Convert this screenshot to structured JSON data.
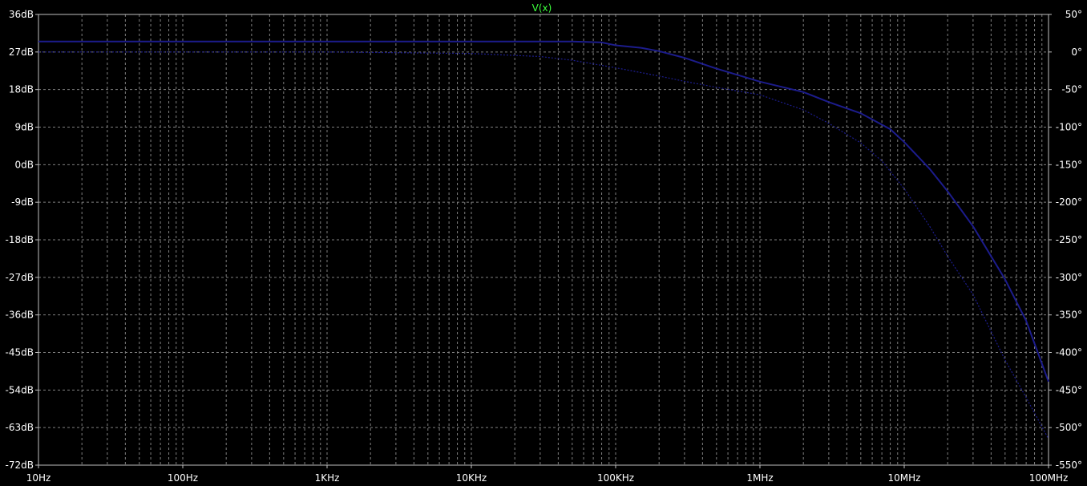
{
  "chart_data": {
    "type": "line",
    "title": "V(x)",
    "xlabel": "",
    "ylabel": "",
    "y2label": "",
    "x_scale": "log",
    "xlim": [
      10,
      100000000
    ],
    "ylim": [
      -72,
      36
    ],
    "y2lim": [
      -550,
      50
    ],
    "x_ticks": [
      "10Hz",
      "100Hz",
      "1KHz",
      "10KHz",
      "100KHz",
      "1MHz",
      "10MHz",
      "100MHz"
    ],
    "y_ticks": [
      "36dB",
      "27dB",
      "18dB",
      "9dB",
      "0dB",
      "-9dB",
      "-18dB",
      "-27dB",
      "-36dB",
      "-45dB",
      "-54dB",
      "-63dB",
      "-72dB"
    ],
    "y2_ticks": [
      "50°",
      "0°",
      "-50°",
      "-100°",
      "-150°",
      "-200°",
      "-250°",
      "-300°",
      "-350°",
      "-400°",
      "-450°",
      "-500°",
      "-550°"
    ],
    "grid": true,
    "colors": {
      "background": "#000000",
      "grid": "#808080",
      "axis": "#c0c0c0",
      "text": "#ffffff",
      "title": "#3cff3c",
      "trace": "#1c1c8c"
    },
    "series": [
      {
        "axis": "left",
        "style": "solid",
        "x": [
          10,
          100,
          1000,
          10000,
          50000,
          80000,
          100000,
          150000,
          200000,
          300000,
          500000,
          1000000,
          2000000,
          3000000,
          5000000,
          8000000,
          10000000,
          15000000,
          20000000,
          30000000,
          50000000,
          70000000,
          100000000
        ],
        "values": [
          29.5,
          29.5,
          29.5,
          29.5,
          29.5,
          29.3,
          28.6,
          28.0,
          27.2,
          25.6,
          23.0,
          19.9,
          17.4,
          15.0,
          12.3,
          8.5,
          5.4,
          -1.0,
          -6.4,
          -14.8,
          -27.5,
          -37.4,
          -52.0
        ]
      },
      {
        "axis": "right",
        "style": "dashed",
        "x": [
          10,
          100,
          1000,
          10000,
          30000,
          50000,
          100000,
          200000,
          300000,
          500000,
          1000000,
          2000000,
          3000000,
          5000000,
          7000000,
          10000000,
          15000000,
          20000000,
          30000000,
          50000000,
          70000000,
          100000000
        ],
        "values": [
          0,
          0,
          0,
          -2,
          -6,
          -11,
          -21,
          -32,
          -39,
          -47,
          -57,
          -77,
          -95,
          -121,
          -145,
          -182,
          -232,
          -272,
          -323,
          -410,
          -460,
          -515
        ]
      }
    ]
  }
}
